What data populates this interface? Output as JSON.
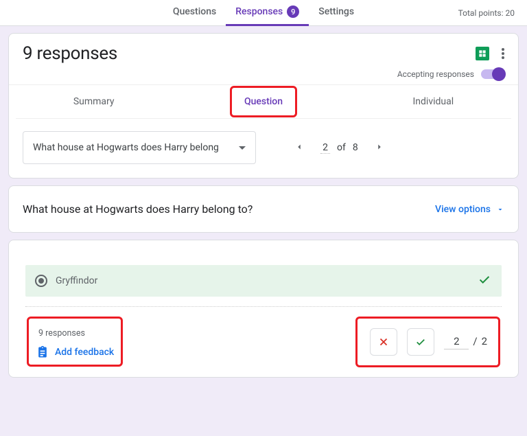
{
  "header": {
    "tabs": [
      {
        "label": "Questions"
      },
      {
        "label": "Responses",
        "badge": "9",
        "active": true
      },
      {
        "label": "Settings"
      }
    ],
    "total_points_label": "Total points:",
    "total_points_value": "20"
  },
  "responses_panel": {
    "title": "9 responses",
    "accepting_label": "Accepting responses",
    "subtabs": {
      "summary": "Summary",
      "question": "Question",
      "individual": "Individual"
    },
    "selector": {
      "text": "What house at Hogwarts does Harry belong"
    },
    "pager": {
      "current": "2",
      "of_label": "of",
      "total": "8"
    }
  },
  "question": {
    "text": "What house at Hogwarts does Harry belong to?",
    "view_options": "View options",
    "correct_answer": "Gryffindor",
    "responses_count": "9 responses",
    "add_feedback": "Add feedback",
    "points_earned": "2",
    "points_max": "2"
  }
}
